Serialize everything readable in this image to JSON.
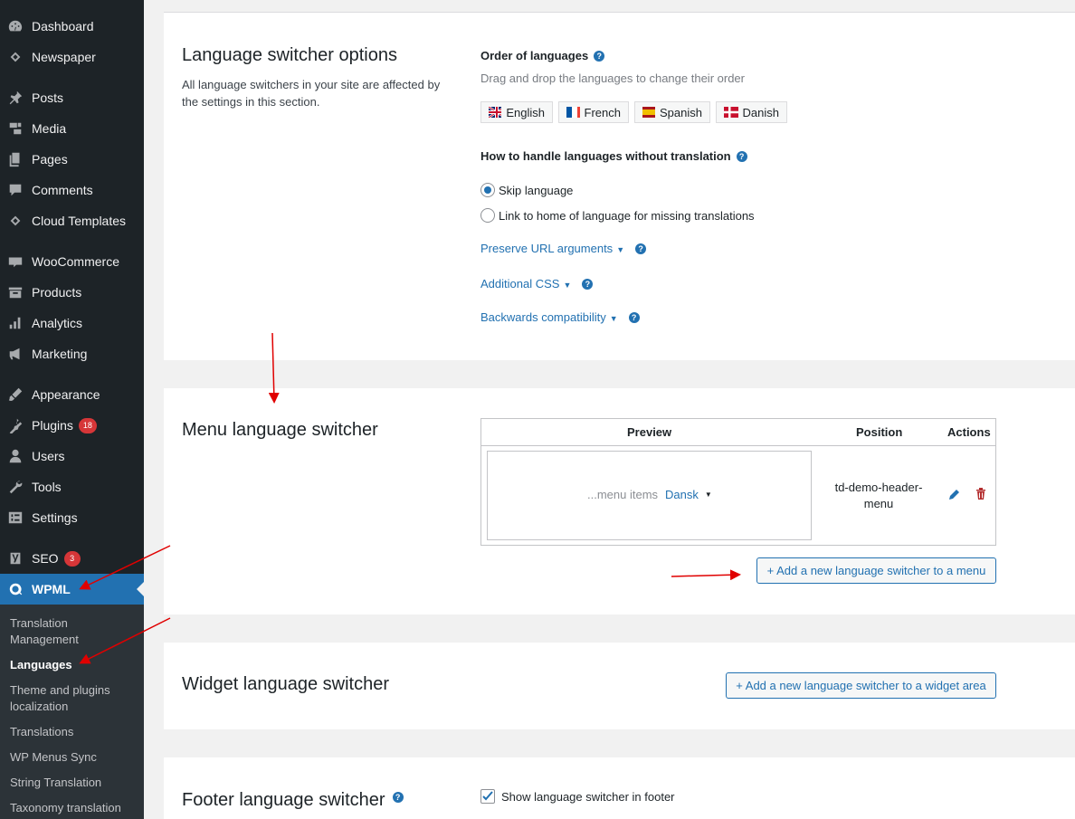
{
  "sidebar": {
    "items": [
      {
        "label": "Dashboard",
        "icon": "dashboard-icon"
      },
      {
        "label": "Newspaper",
        "icon": "newspaper-icon"
      },
      {
        "label": "Posts",
        "icon": "pin-icon"
      },
      {
        "label": "Media",
        "icon": "media-icon"
      },
      {
        "label": "Pages",
        "icon": "pages-icon"
      },
      {
        "label": "Comments",
        "icon": "comments-icon"
      },
      {
        "label": "Cloud Templates",
        "icon": "cloud-templates-icon"
      },
      {
        "label": "WooCommerce",
        "icon": "woocommerce-icon"
      },
      {
        "label": "Products",
        "icon": "products-icon"
      },
      {
        "label": "Analytics",
        "icon": "analytics-icon"
      },
      {
        "label": "Marketing",
        "icon": "marketing-icon"
      },
      {
        "label": "Appearance",
        "icon": "appearance-icon"
      },
      {
        "label": "Plugins",
        "icon": "plugins-icon",
        "badge": "18"
      },
      {
        "label": "Users",
        "icon": "users-icon"
      },
      {
        "label": "Tools",
        "icon": "tools-icon"
      },
      {
        "label": "Settings",
        "icon": "settings-icon"
      },
      {
        "label": "SEO",
        "icon": "yoast-icon",
        "badge": "3"
      },
      {
        "label": "WPML",
        "icon": "wpml-icon"
      }
    ],
    "submenu": [
      {
        "label": "Translation Management"
      },
      {
        "label": "Languages"
      },
      {
        "label": "Theme and plugins localization"
      },
      {
        "label": "Translations"
      },
      {
        "label": "WP Menus Sync"
      },
      {
        "label": "String Translation"
      },
      {
        "label": "Taxonomy translation"
      }
    ]
  },
  "options": {
    "title": "Language switcher options",
    "description": "All language switchers in your site are affected by the settings in this section.",
    "order_label": "Order of languages",
    "order_hint": "Drag and drop the languages to change their order",
    "languages": [
      {
        "label": "English",
        "flag": "uk-flag-icon"
      },
      {
        "label": "French",
        "flag": "france-flag-icon"
      },
      {
        "label": "Spanish",
        "flag": "spain-flag-icon"
      },
      {
        "label": "Danish",
        "flag": "denmark-flag-icon"
      }
    ],
    "handle_label": "How to handle languages without translation",
    "radio_skip": "Skip language",
    "radio_link": "Link to home of language for missing translations",
    "preserve_url": "Preserve URL arguments",
    "additional_css": "Additional CSS",
    "backwards": "Backwards compatibility"
  },
  "menu_switcher": {
    "title": "Menu language switcher",
    "col_preview": "Preview",
    "col_position": "Position",
    "col_actions": "Actions",
    "preview_items": "...menu items",
    "preview_lang": "Dansk",
    "position": "td-demo-header-menu",
    "add_button": "+ Add a new language switcher to a menu"
  },
  "widget_switcher": {
    "title": "Widget language switcher",
    "add_button": "+ Add a new language switcher to a widget area"
  },
  "footer_switcher": {
    "title": "Footer language switcher",
    "checkbox_label": "Show language switcher in footer"
  },
  "colors": {
    "accent": "#2271b1",
    "sidebar_bg": "#1d2327",
    "badge": "#d63638",
    "annotation_arrow": "#e00000"
  }
}
